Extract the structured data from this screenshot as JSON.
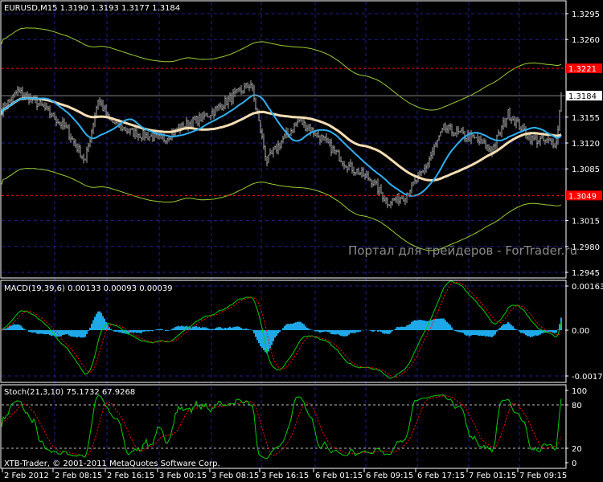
{
  "header": {
    "symbol_label": "EURUSD,M15  1.3190 1.3193 1.3177 1.3184"
  },
  "watermark": "Портал для трейдеров - ForTrader.ru",
  "copyright": "XTB-Trader, © 2001-2011 MetaQuotes Software Corp.",
  "colors": {
    "bg": "#000000",
    "grid": "#1f1f8f",
    "bars": "#b0b0b0",
    "ma_fast": "#2fb0f0",
    "ma_slow": "#f5deb3",
    "envelope": "#9acd32",
    "level": "#ff0000",
    "macd_hist": "#1ea8e8",
    "signal": "#ff0000",
    "main": "#00d000"
  },
  "chart_data": [
    {
      "type": "line",
      "title": "EURUSD,M15",
      "ohlc_last": {
        "open": 1.319,
        "high": 1.3193,
        "low": 1.3177,
        "close": 1.3184
      },
      "x_ticks": [
        "2 Feb 2012",
        "2 Feb 08:15",
        "2 Feb 16:15",
        "3 Feb 00:15",
        "3 Feb 08:15",
        "3 Feb 16:15",
        "6 Feb 01:15",
        "6 Feb 09:15",
        "6 Feb 17:15",
        "7 Feb 01:15",
        "7 Feb 09:15"
      ],
      "y_ticks": [
        "1.3295",
        "1.3260",
        "1.3155",
        "1.3120",
        "1.3085",
        "1.3015",
        "1.2980",
        "1.2945"
      ],
      "ylim": [
        1.2945,
        1.331
      ],
      "levels": [
        {
          "value": 1.3221,
          "label": "1.3221"
        },
        {
          "value": 1.3049,
          "label": "1.3049"
        }
      ],
      "current_price": {
        "value": 1.3184,
        "label": "1.3184"
      },
      "close_keypoints": {
        "bar": [
          0,
          10,
          25,
          40,
          52,
          60,
          67,
          80,
          100,
          115,
          130,
          145,
          155,
          165,
          175,
          185,
          200,
          215,
          230,
          240,
          250,
          262,
          275,
          282,
          288,
          295,
          305,
          315,
          330,
          345,
          348
        ],
        "price": [
          1.3165,
          1.319,
          1.317,
          1.314,
          1.3095,
          1.318,
          1.315,
          1.3135,
          1.3125,
          1.3145,
          1.316,
          1.3185,
          1.32,
          1.3095,
          1.3125,
          1.315,
          1.3125,
          1.309,
          1.307,
          1.304,
          1.3048,
          1.308,
          1.314,
          1.3135,
          1.313,
          1.3125,
          1.311,
          1.316,
          1.3125,
          1.312,
          1.3184
        ]
      }
    },
    {
      "type": "line",
      "title": "MACD(19,39,6) 0.00133 0.00093 0.00039",
      "y_ticks": [
        "0.00163",
        "0.00",
        "-0.00172"
      ],
      "ylim": [
        -0.00172,
        0.00163
      ]
    },
    {
      "type": "line",
      "title": "Stoch(21,3,10) 75.1732 67.9268",
      "y_ticks": [
        "100",
        "80",
        "20",
        "0"
      ],
      "ylim": [
        0,
        100
      ]
    }
  ]
}
